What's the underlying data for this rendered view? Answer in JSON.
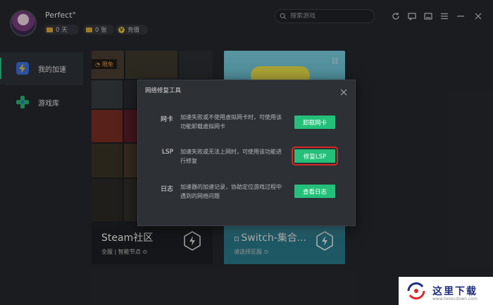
{
  "header": {
    "username": "Perfect°",
    "days": "0 天",
    "cards": "0 张",
    "recharge": "充值",
    "search_placeholder": "搜索游戏"
  },
  "sidebar": {
    "items": [
      {
        "label": "我的加速",
        "icon": "bolt-icon",
        "active": true
      },
      {
        "label": "游戏库",
        "icon": "gamepad-icon",
        "active": false
      }
    ]
  },
  "cards": [
    {
      "title": "Steam社区",
      "subtitle": "全服 | 智能节点",
      "badge": "限免"
    },
    {
      "title": "Switch-集合...",
      "subtitle": "请选择区服"
    }
  ],
  "dialog": {
    "title": "网络修复工具",
    "rows": [
      {
        "label": "网卡",
        "desc": "加速失败或不使用虚拟网卡时，可使用该功能卸载虚拟网卡",
        "button": "卸载网卡"
      },
      {
        "label": "LSP",
        "desc": "加速失败或无法上网时，可使用该功能进行修复",
        "button": "修复LSP"
      },
      {
        "label": "日志",
        "desc": "加速器的加速记录，协助定位游戏过程中遇到的网络问题",
        "button": "查看日志"
      }
    ]
  },
  "watermark": {
    "text": "这里下载",
    "url": "www.herecdown.com"
  },
  "colors": {
    "accent": "#24c07a",
    "background": "#25282d",
    "highlight": "#d82626"
  }
}
